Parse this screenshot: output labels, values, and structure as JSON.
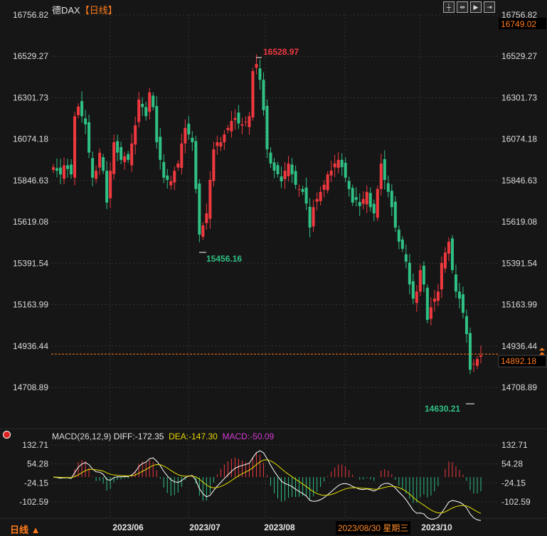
{
  "header": {
    "instrument": "德DAX",
    "period": "【日线】"
  },
  "toolbar": {
    "icons": [
      "crosshair-icon",
      "fit-range-icon",
      "play-icon",
      "go-latest-icon"
    ]
  },
  "price_axis": {
    "ticks": [
      "16756.82",
      "16529.27",
      "16301.73",
      "16074.18",
      "15846.63",
      "15619.08",
      "15391.54",
      "15163.99",
      "14936.44",
      "14708.89"
    ],
    "top_value": "16749.02",
    "last_price": "14892.18"
  },
  "annotations": {
    "high": "16528.97",
    "mid_low": "15456.16",
    "low": "14630.21"
  },
  "macd": {
    "title": "MACD(26,12,9)",
    "diff": "DIFF:-172.35",
    "dea": "DEA:-147.30",
    "macd": "MACD:-50.09",
    "ticks": [
      "132.71",
      "54.28",
      "-24.15",
      "-102.59"
    ]
  },
  "x_axis": {
    "labels": [
      "2023/06",
      "2023/07",
      "2023/08",
      "2023/10"
    ],
    "crosshair_date": "2023/08/30 星期三"
  },
  "footer": {
    "period": "日线 ▲"
  },
  "colors": {
    "up": "#f0383f",
    "down": "#2fc084",
    "diff": "#ffffff",
    "dea": "#e5e000",
    "accent": "#ff7a1a"
  },
  "chart_data": {
    "type": "candlestick",
    "price_range": [
      14708.89,
      16756.82
    ],
    "grid": true,
    "closes": [
      15920,
      15900,
      15880,
      15930,
      15910,
      15880,
      16200,
      16253,
      16200,
      16155,
      16000,
      15862,
      15900,
      15999,
      15900,
      15725,
      15900,
      16057,
      16000,
      15960,
      15980,
      15960,
      16050,
      16150,
      16292,
      16250,
      16200,
      16331,
      16250,
      16057,
      15960,
      15862,
      15850,
      15842,
      15900,
      15940,
      16050,
      16135,
      16100,
      16057,
      15800,
      15549,
      15600,
      15666,
      15850,
      16018,
      16057,
      16057,
      16100,
      16135,
      16174,
      16190,
      16160,
      16155,
      16170,
      16200,
      16448,
      16487,
      16400,
      16233,
      16018,
      15940,
      15901,
      15881,
      15842,
      15900,
      15940,
      15881,
      15823,
      15800,
      15784,
      15720,
      15588,
      15700,
      15745,
      15784,
      15823,
      15880,
      15901,
      15940,
      15960,
      15920,
      15862,
      15800,
      15725,
      15740,
      15706,
      15745,
      15784,
      15700,
      15666,
      15800,
      15940,
      15850,
      15784,
      15700,
      15588,
      15510,
      15471,
      15400,
      15275,
      15197,
      15236,
      15354,
      15275,
      15080,
      15150,
      15197,
      15236,
      15393,
      15450,
      15510,
      15354,
      15236,
      15197,
      15119,
      15002,
      14806,
      14840,
      14865,
      14885
    ]
  }
}
